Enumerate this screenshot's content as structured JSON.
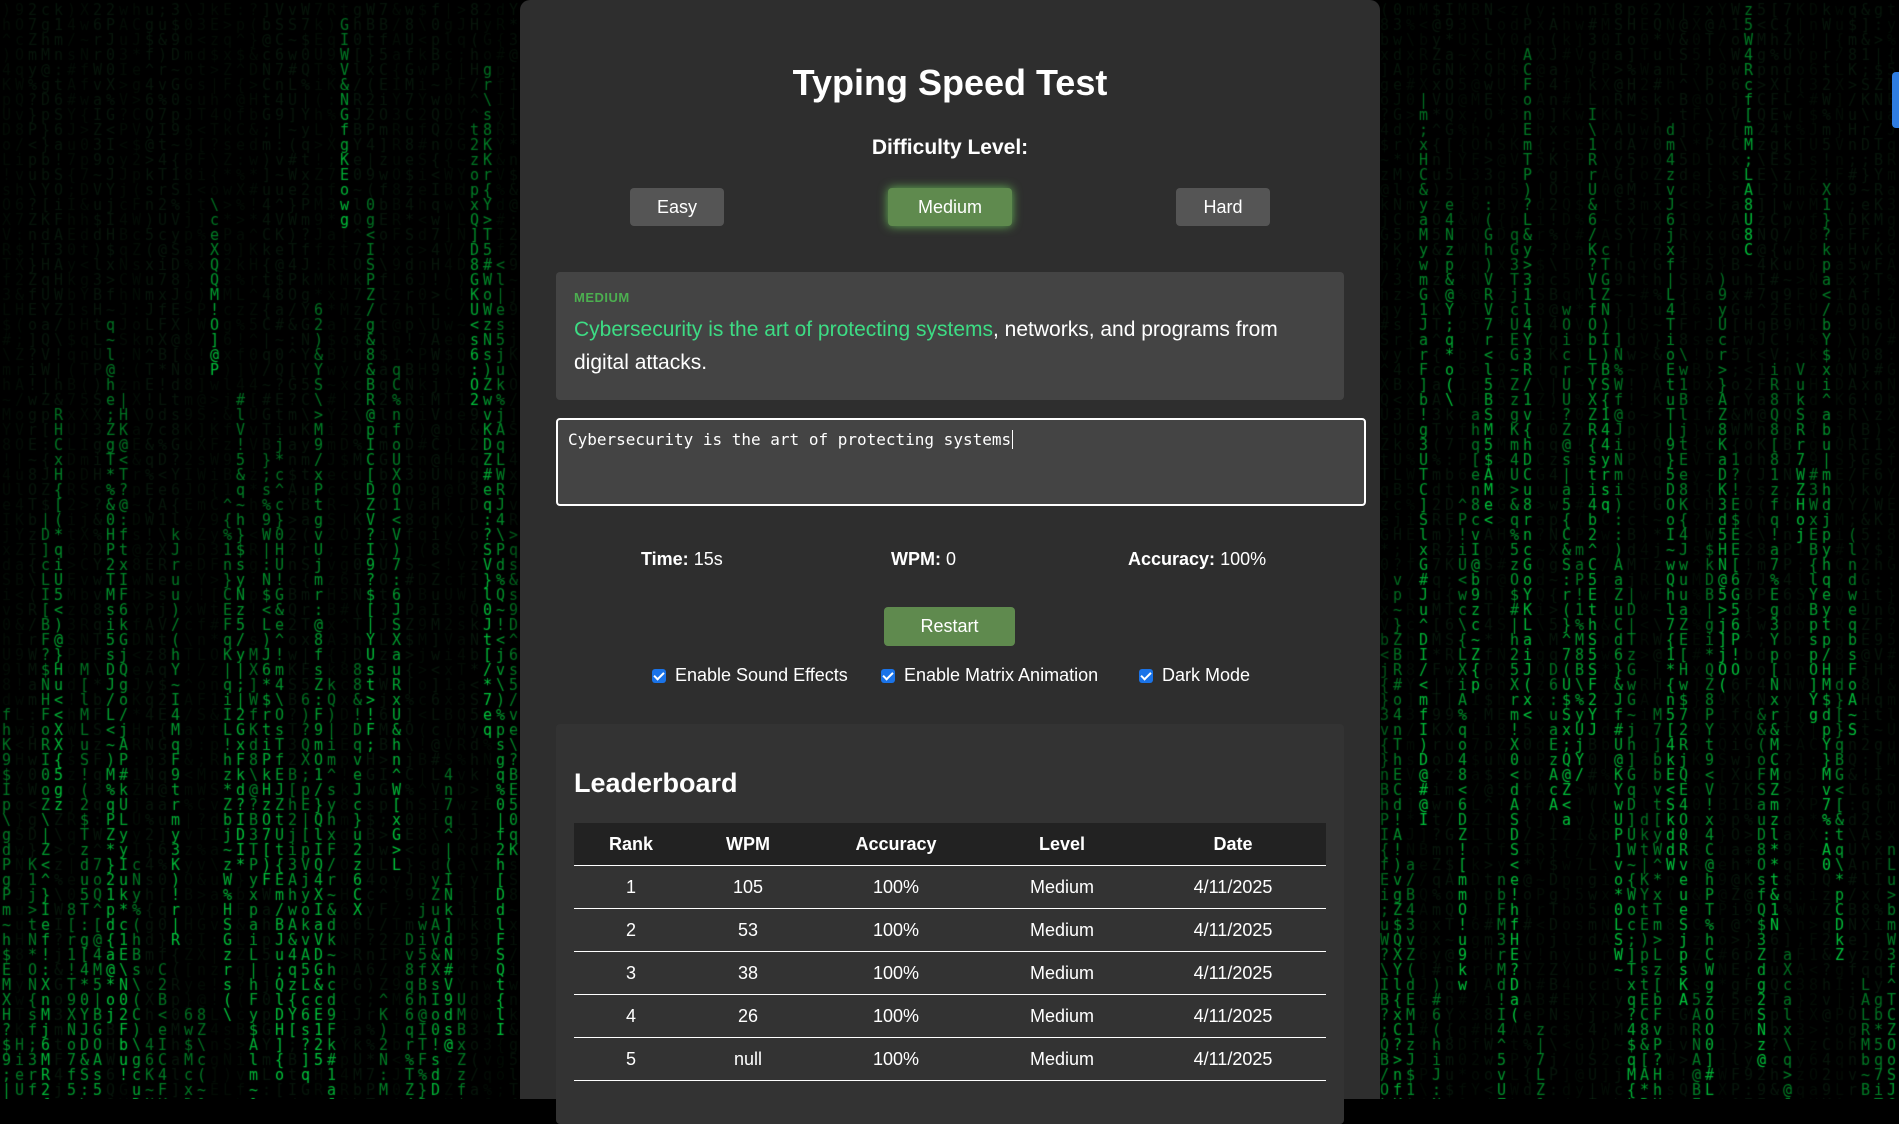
{
  "app": {
    "title": "Typing Speed Test",
    "difficulty_label": "Difficulty Level:",
    "difficulty_options": [
      {
        "label": "Easy",
        "active": false
      },
      {
        "label": "Medium",
        "active": true
      },
      {
        "label": "Hard",
        "active": false
      }
    ]
  },
  "passage": {
    "level_tag": "MEDIUM",
    "typed_text": "Cybersecurity is the art of protecting systems",
    "remaining_text": ", networks, and programs from digital attacks."
  },
  "input": {
    "value": "Cybersecurity is the art of protecting systems"
  },
  "stats": {
    "time_label": "Time:",
    "time_value": "15s",
    "wpm_label": "WPM:",
    "wpm_value": "0",
    "accuracy_label": "Accuracy:",
    "accuracy_value": "100%"
  },
  "controls": {
    "restart_label": "Restart",
    "options": [
      {
        "label": "Enable Sound Effects",
        "checked": true
      },
      {
        "label": "Enable Matrix Animation",
        "checked": true
      },
      {
        "label": "Dark Mode",
        "checked": true
      }
    ]
  },
  "leaderboard": {
    "title": "Leaderboard",
    "columns": [
      "Rank",
      "WPM",
      "Accuracy",
      "Level",
      "Date"
    ],
    "rows": [
      [
        "1",
        "105",
        "100%",
        "Medium",
        "4/11/2025"
      ],
      [
        "2",
        "53",
        "100%",
        "Medium",
        "4/11/2025"
      ],
      [
        "3",
        "38",
        "100%",
        "Medium",
        "4/11/2025"
      ],
      [
        "4",
        "26",
        "100%",
        "Medium",
        "4/11/2025"
      ],
      [
        "5",
        "null",
        "100%",
        "Medium",
        "4/11/2025"
      ]
    ]
  },
  "colors": {
    "matrix_green": "#00c83c",
    "accent_green": "#5f8a4e",
    "typed_text": "#3ddc84",
    "panel_bg": "#2e2e2e",
    "checkbox_blue": "#1a73e8"
  }
}
